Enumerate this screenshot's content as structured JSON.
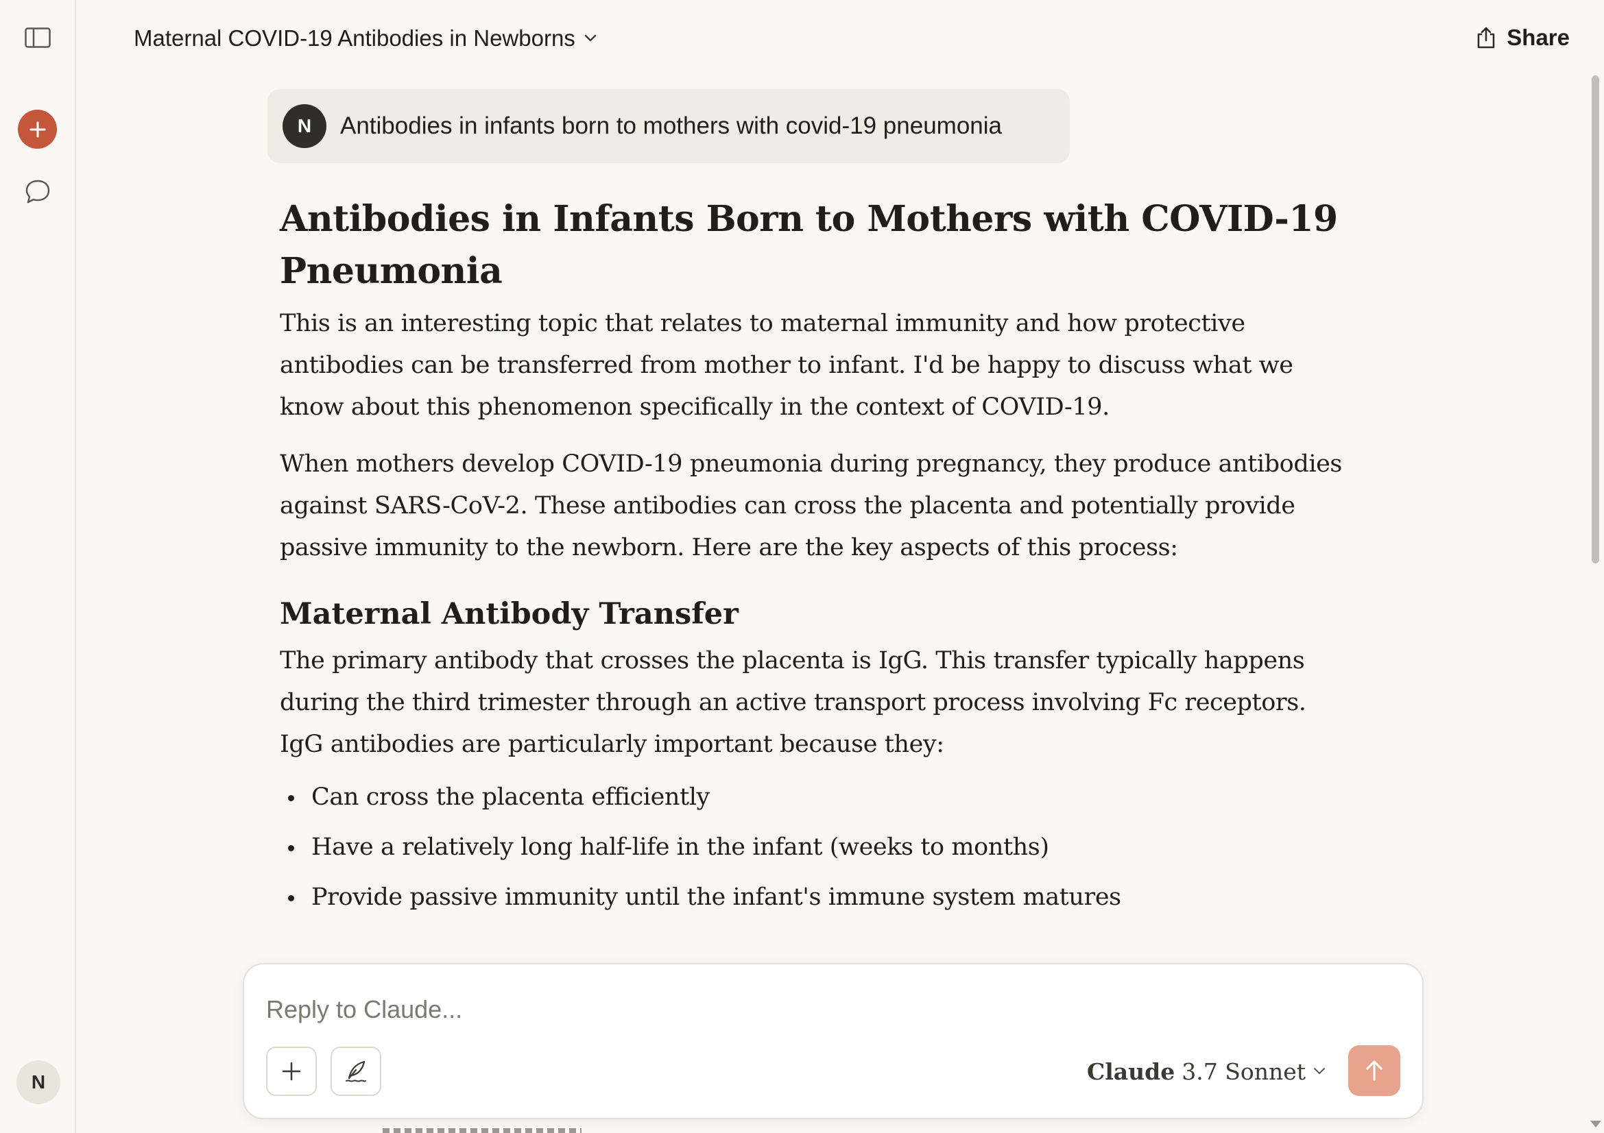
{
  "sidebar": {
    "toggle_icon": "sidebar-toggle-icon",
    "new_chat_icon": "plus-icon",
    "chats_icon": "chat-bubble-icon",
    "user_initial": "N",
    "accent_color": "#c4563a"
  },
  "header": {
    "title": "Maternal COVID-19 Antibodies in Newborns",
    "share_label": "Share"
  },
  "user_message": {
    "initial": "N",
    "text": "Antibodies in infants born to mothers with covid-19 pneumonia"
  },
  "response": {
    "heading": "Antibodies in Infants Born to Mothers with COVID-19 Pneumonia",
    "paragraphs": [
      "This is an interesting topic that relates to maternal immunity and how protective antibodies can be transferred from mother to infant. I'd be happy to discuss what we know about this phenomenon specifically in the context of COVID-19.",
      "When mothers develop COVID-19 pneumonia during pregnancy, they produce antibodies against SARS-CoV-2. These antibodies can cross the placenta and potentially provide passive immunity to the newborn. Here are the key aspects of this process:"
    ],
    "subheading": "Maternal Antibody Transfer",
    "sub_paragraph": "The primary antibody that crosses the placenta is IgG. This transfer typically happens during the third trimester through an active transport process involving Fc receptors. IgG antibodies are particularly important because they:",
    "bullets": [
      "Can cross the placenta efficiently",
      "Have a relatively long half-life in the infant (weeks to months)",
      "Provide passive immunity until the infant's immune system matures"
    ]
  },
  "composer": {
    "placeholder": "Reply to Claude...",
    "value": "",
    "model_brand": "Claude",
    "model_version": "3.7 Sonnet",
    "send_color": "#e8a38e"
  }
}
